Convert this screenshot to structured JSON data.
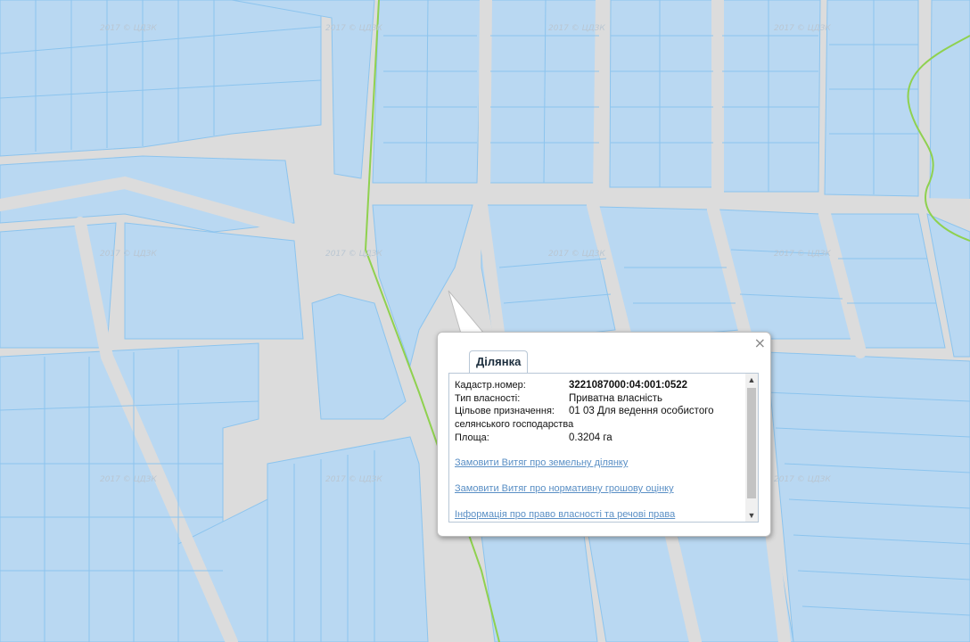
{
  "map": {
    "watermark": "2017 © ЦДЗК",
    "colors": {
      "background": "#dcdcdc",
      "parcel_fill": "#b9d8f2",
      "parcel_stroke": "#8cc4ee",
      "boundary": "#8fd14f"
    }
  },
  "popup": {
    "close_label": "×",
    "tab_label": "Ділянка",
    "fields": [
      {
        "label": "Кадастр.номер:",
        "value": "3221087000:04:001:0522"
      },
      {
        "label": "Тип власності:",
        "value": "Приватна власність"
      },
      {
        "label": "Цільове призначення:",
        "value": "01 03 Для ведення особистого"
      },
      {
        "label": "",
        "value": "селянського господарства"
      },
      {
        "label": "Площа:",
        "value": "0.3204 га"
      }
    ],
    "links": [
      "Замовити Витяг про земельну ділянку",
      "Замовити Витяг про нормативну грошову оцінку",
      "Інформація про право власності та речові права"
    ],
    "scroll_up": "▲",
    "scroll_down": "▼"
  }
}
